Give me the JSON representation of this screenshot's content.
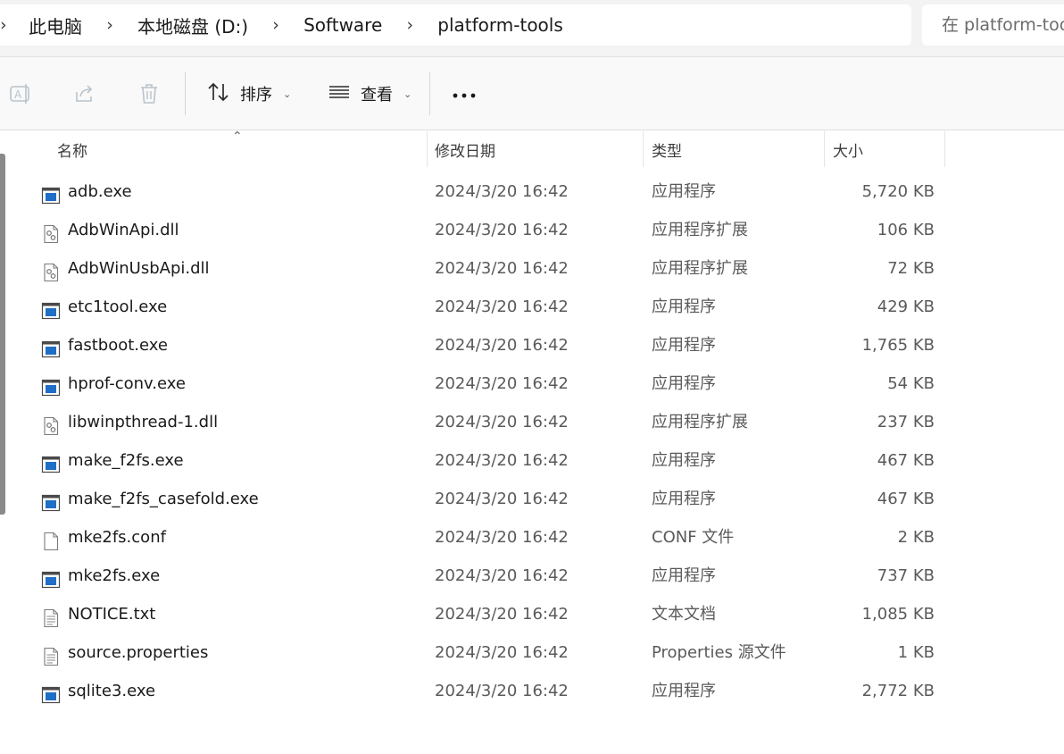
{
  "breadcrumb": {
    "items": [
      "此电脑",
      "本地磁盘 (D:)",
      "Software",
      "platform-tools"
    ]
  },
  "search": {
    "placeholder": "在 platform-tools 中搜索"
  },
  "toolbar": {
    "sort_label": "排序",
    "view_label": "查看"
  },
  "columns": {
    "name": "名称",
    "date": "修改日期",
    "type": "类型",
    "size": "大小"
  },
  "files": [
    {
      "name": "adb.exe",
      "date": "2024/3/20 16:42",
      "type": "应用程序",
      "size": "5,720 KB",
      "icon": "exe-icon"
    },
    {
      "name": "AdbWinApi.dll",
      "date": "2024/3/20 16:42",
      "type": "应用程序扩展",
      "size": "106 KB",
      "icon": "dll-icon"
    },
    {
      "name": "AdbWinUsbApi.dll",
      "date": "2024/3/20 16:42",
      "type": "应用程序扩展",
      "size": "72 KB",
      "icon": "dll-icon"
    },
    {
      "name": "etc1tool.exe",
      "date": "2024/3/20 16:42",
      "type": "应用程序",
      "size": "429 KB",
      "icon": "exe-icon"
    },
    {
      "name": "fastboot.exe",
      "date": "2024/3/20 16:42",
      "type": "应用程序",
      "size": "1,765 KB",
      "icon": "exe-icon"
    },
    {
      "name": "hprof-conv.exe",
      "date": "2024/3/20 16:42",
      "type": "应用程序",
      "size": "54 KB",
      "icon": "exe-icon"
    },
    {
      "name": "libwinpthread-1.dll",
      "date": "2024/3/20 16:42",
      "type": "应用程序扩展",
      "size": "237 KB",
      "icon": "dll-icon"
    },
    {
      "name": "make_f2fs.exe",
      "date": "2024/3/20 16:42",
      "type": "应用程序",
      "size": "467 KB",
      "icon": "exe-icon"
    },
    {
      "name": "make_f2fs_casefold.exe",
      "date": "2024/3/20 16:42",
      "type": "应用程序",
      "size": "467 KB",
      "icon": "exe-icon"
    },
    {
      "name": "mke2fs.conf",
      "date": "2024/3/20 16:42",
      "type": "CONF 文件",
      "size": "2 KB",
      "icon": "blank-file-icon"
    },
    {
      "name": "mke2fs.exe",
      "date": "2024/3/20 16:42",
      "type": "应用程序",
      "size": "737 KB",
      "icon": "exe-icon"
    },
    {
      "name": "NOTICE.txt",
      "date": "2024/3/20 16:42",
      "type": "文本文档",
      "size": "1,085 KB",
      "icon": "text-file-icon"
    },
    {
      "name": "source.properties",
      "date": "2024/3/20 16:42",
      "type": "Properties 源文件",
      "size": "1 KB",
      "icon": "text-file-icon"
    },
    {
      "name": "sqlite3.exe",
      "date": "2024/3/20 16:42",
      "type": "应用程序",
      "size": "2,772 KB",
      "icon": "exe-icon"
    }
  ],
  "colors": {
    "exe_blue": "#1f6fc7",
    "toolbar_bg": "#f9f9f9",
    "topbar_bg": "#f3f3f3",
    "disabled_icon": "#b9c3cc"
  }
}
